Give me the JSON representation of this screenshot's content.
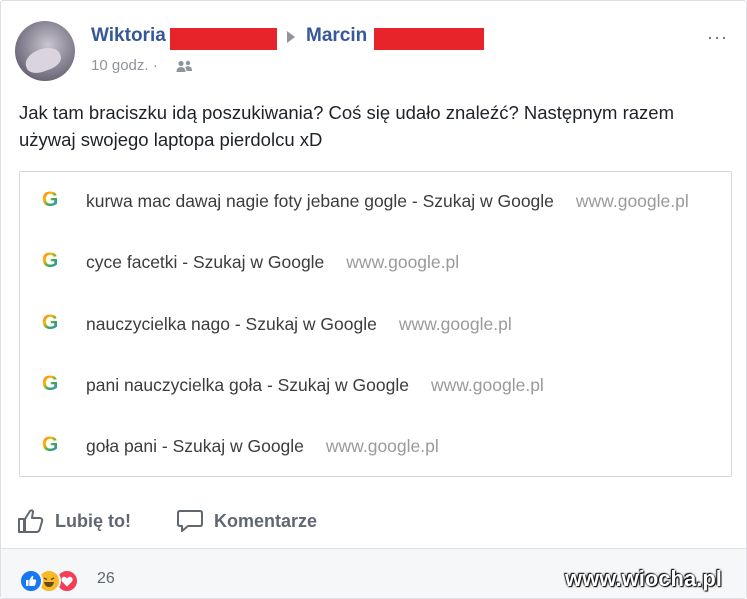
{
  "post": {
    "author_first": "Wiktoria",
    "recipient_first": "Marcin",
    "time": "10 godz. ·",
    "more": "···",
    "text": "Jak tam braciszku idą poszukiwania? Coś się udało znaleźć? Następnym razem używaj swojego laptopa pierdolcu xD"
  },
  "history": [
    {
      "icon": "G",
      "title": "kurwa mac dawaj nagie foty jebane gogle - Szukaj w Google",
      "url": "www.google.pl"
    },
    {
      "icon": "G",
      "title": "cyce facetki - Szukaj w Google",
      "url": "www.google.pl"
    },
    {
      "icon": "G",
      "title": "nauczycielka nago - Szukaj w Google",
      "url": "www.google.pl"
    },
    {
      "icon": "G",
      "title": "pani nauczycielka goła - Szukaj w Google",
      "url": "www.google.pl"
    },
    {
      "icon": "G",
      "title": "goła pani - Szukaj w Google",
      "url": "www.google.pl"
    }
  ],
  "actions": {
    "like": "Lubię to!",
    "comment": "Komentarze"
  },
  "reactions": {
    "count": "26",
    "watermark": "www.wiocha.pl"
  },
  "colors": {
    "link_blue": "#365899",
    "redaction": "#e8242b",
    "like_blue": "#1877f2",
    "haha_yellow": "#f7b928",
    "love_red": "#f33e58"
  }
}
